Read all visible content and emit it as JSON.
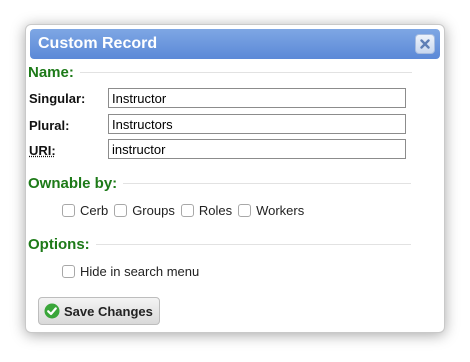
{
  "dialog": {
    "title": "Custom Record",
    "close_icon": "close-icon"
  },
  "sections": {
    "name": "Name:",
    "ownable": "Ownable by:",
    "options": "Options:"
  },
  "fields": {
    "singular": {
      "label": "Singular:",
      "value": "Instructor"
    },
    "plural": {
      "label": "Plural:",
      "value": "Instructors"
    },
    "uri": {
      "label": "URI:",
      "value": "instructor"
    }
  },
  "ownable_by": [
    {
      "label": "Cerb",
      "checked": false
    },
    {
      "label": "Groups",
      "checked": false
    },
    {
      "label": "Roles",
      "checked": false
    },
    {
      "label": "Workers",
      "checked": false
    }
  ],
  "options": {
    "hide_in_search_menu": {
      "label": "Hide in search menu",
      "checked": false
    }
  },
  "save_button": {
    "label": "Save Changes",
    "icon": "checkmark-circle-icon",
    "icon_color": "#3aa63a"
  },
  "colors": {
    "titlebar": "#6b97dd",
    "section_heading": "#1d7a18"
  }
}
